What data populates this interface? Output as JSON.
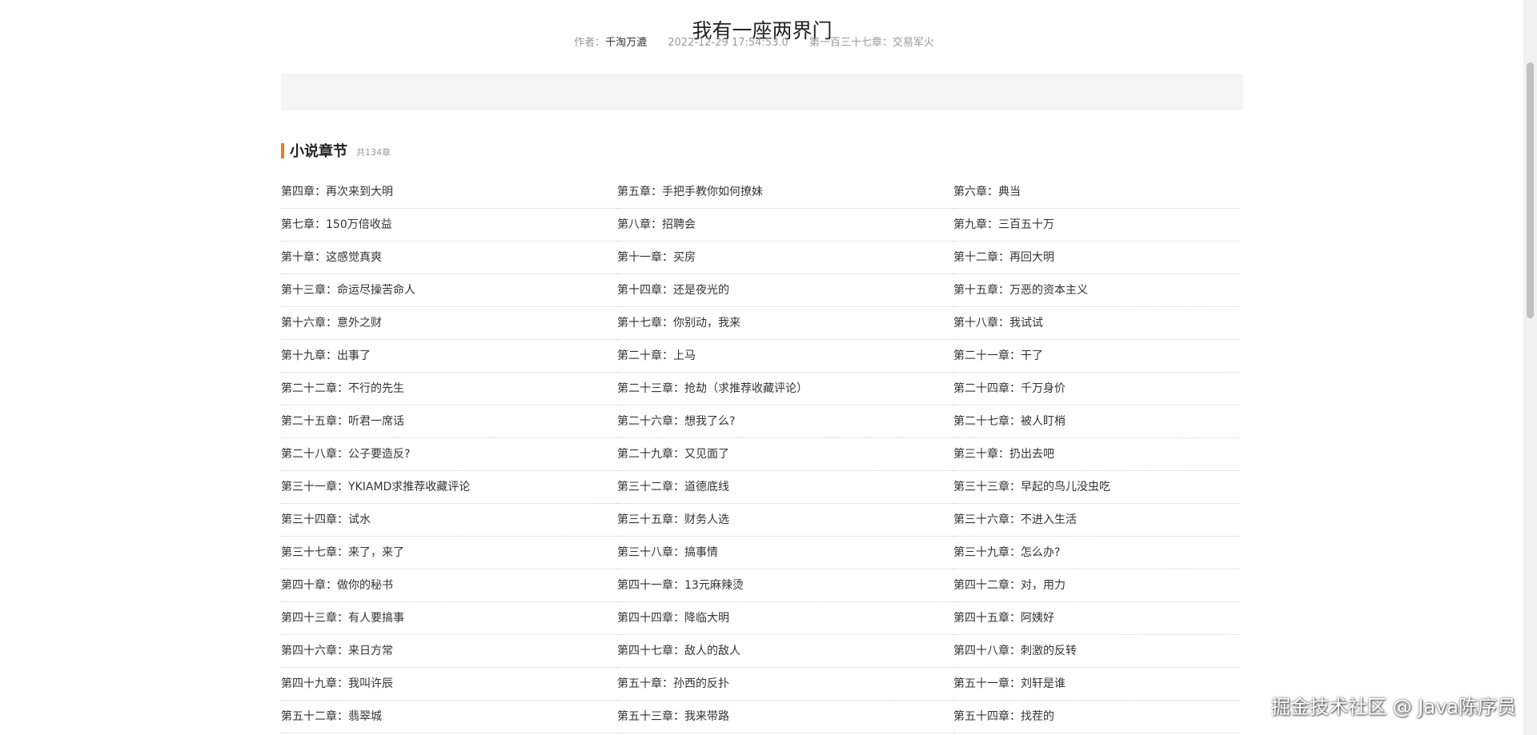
{
  "book": {
    "title": "我有一座两界门",
    "author_label": "作者：",
    "author": "千淘万漉",
    "updated": "2022-12-29 17:54:53.0",
    "latest_chapter": "第一百三十七章：交易军火"
  },
  "section": {
    "title": "小说章节",
    "count": "共134章"
  },
  "chapters": [
    "第四章：再次来到大明",
    "第五章：手把手教你如何撩妹",
    "第六章：典当",
    "第七章：150万倍收益",
    "第八章：招聘会",
    "第九章：三百五十万",
    "第十章：这感觉真爽",
    "第十一章：买房",
    "第十二章：再回大明",
    "第十三章：命运尽操苦命人",
    "第十四章：还是夜光的",
    "第十五章：万恶的资本主义",
    "第十六章：意外之财",
    "第十七章：你别动，我来",
    "第十八章：我试试",
    "第十九章：出事了",
    "第二十章：上马",
    "第二十一章：干了",
    "第二十二章：不行的先生",
    "第二十三章：抢劫（求推荐收藏评论）",
    "第二十四章：千万身价",
    "第二十五章：听君一席话",
    "第二十六章：想我了么?",
    "第二十七章：被人盯梢",
    "第二十八章：公子要造反?",
    "第二十九章：又见面了",
    "第三十章：扔出去吧",
    "第三十一章：YKIAMD求推荐收藏评论",
    "第三十二章：道德底线",
    "第三十三章：早起的鸟儿没虫吃",
    "第三十四章：试水",
    "第三十五章：财务人选",
    "第三十六章：不进入生活",
    "第三十七章：来了，来了",
    "第三十八章：搞事情",
    "第三十九章：怎么办?",
    "第四十章：做你的秘书",
    "第四十一章：13元麻辣烫",
    "第四十二章：对，用力",
    "第四十三章：有人要搞事",
    "第四十四章：降临大明",
    "第四十五章：阿姨好",
    "第四十六章：来日方常",
    "第四十七章：敌人的敌人",
    "第四十八章：刺激的反转",
    "第四十九章：我叫许辰",
    "第五十章：孙西的反扑",
    "第五十一章：刘轩是谁",
    "第五十二章：翡翠城",
    "第五十三章：我来带路",
    "第五十四章：找茬的"
  ],
  "watermark": "掘金技术社区 @ Java陈序员"
}
